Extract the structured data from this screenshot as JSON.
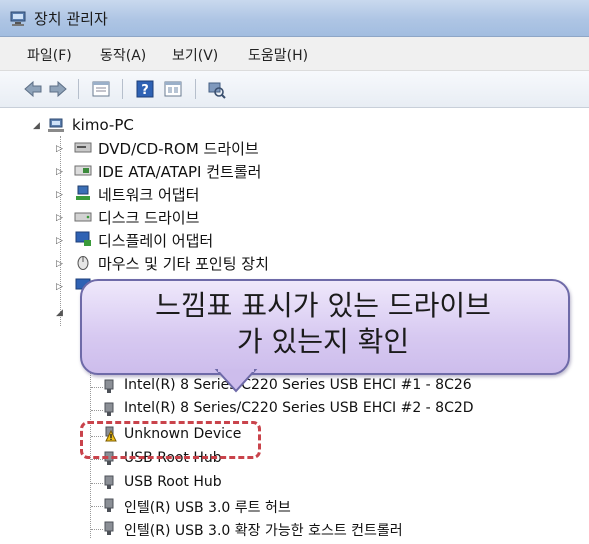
{
  "window": {
    "title": "장치 관리자",
    "title_icon": "device-manager-icon"
  },
  "menu": [
    {
      "label": "파일(F)"
    },
    {
      "label": "동작(A)"
    },
    {
      "label": "보기(V)"
    },
    {
      "label": "도움말(H)"
    }
  ],
  "toolbar": {
    "buttons": [
      "back-arrow-icon",
      "forward-arrow-icon",
      "properties-icon",
      "help-icon",
      "view-icon",
      "scan-hardware-icon"
    ]
  },
  "tree": {
    "root": "kimo-PC",
    "categories": [
      {
        "label": "DVD/CD-ROM 드라이브",
        "icon": "optical-drive-icon"
      },
      {
        "label": "IDE ATA/ATAPI 컨트롤러",
        "icon": "ide-controller-icon"
      },
      {
        "label": "네트워크 어댑터",
        "icon": "network-adapter-icon"
      },
      {
        "label": "디스크 드라이브",
        "icon": "disk-drive-icon"
      },
      {
        "label": "디스플레이 어댑터",
        "icon": "display-adapter-icon"
      },
      {
        "label": "마우스 및 기타 포인팅 장치",
        "icon": "mouse-icon"
      }
    ],
    "usb_children": [
      {
        "label": "Intel(R) 8 Series/C220 Series USB EHCI #1 - 8C26",
        "icon": "usb-plug-icon"
      },
      {
        "label": "Intel(R) 8 Series/C220 Series USB EHCI #2 - 8C2D",
        "icon": "usb-plug-icon"
      },
      {
        "label": "Unknown Device",
        "icon": "warning-usb-icon"
      },
      {
        "label": "USB Root Hub",
        "icon": "usb-plug-icon"
      },
      {
        "label": "USB Root Hub",
        "icon": "usb-plug-icon"
      },
      {
        "label": "인텔(R) USB 3.0 루트 허브",
        "icon": "usb-plug-icon"
      },
      {
        "label": "인텔(R) USB 3.0 확장 가능한 호스트 컨트롤러",
        "icon": "usb-plug-icon"
      }
    ]
  },
  "callout": {
    "line1": "느낌표 표시가 있는 드라이브",
    "line2": "가 있는지 확인"
  },
  "colors": {
    "callout_border": "#6e6aa8",
    "callout_fill": "#d7c9f1",
    "highlight": "#c9434b",
    "warning": "#f2c21a"
  }
}
